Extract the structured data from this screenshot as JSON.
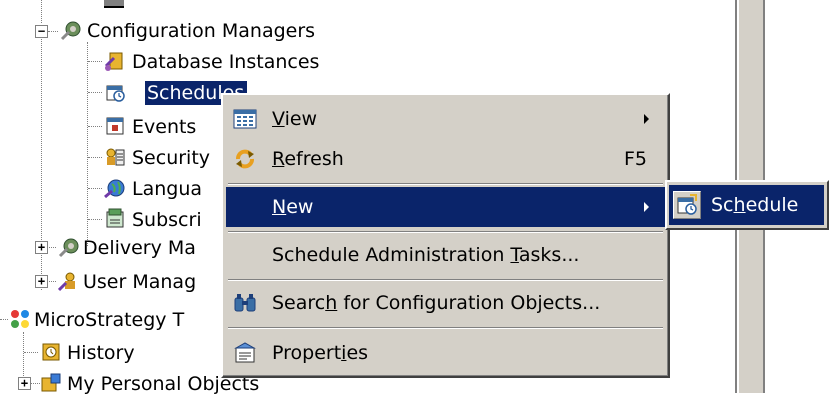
{
  "tree": {
    "items": [
      {
        "label": "Configuration Managers",
        "icon": "gear-wrench-icon",
        "toggle": "−"
      },
      {
        "label": "Database Instances",
        "icon": "database-instance-icon"
      },
      {
        "label": "Schedules",
        "icon": "schedule-icon",
        "selected": true
      },
      {
        "label": "Events",
        "icon": "event-icon"
      },
      {
        "label": "Security",
        "icon": "security-icon"
      },
      {
        "label": "Langua",
        "icon": "language-globe-icon"
      },
      {
        "label": "Subscri",
        "icon": "subscription-icon"
      },
      {
        "label": "Delivery Ma",
        "icon": "gear-wrench-icon",
        "toggle": "+"
      },
      {
        "label": "User Manag",
        "icon": "user-manager-icon",
        "toggle": "+"
      },
      {
        "label": "MicroStrategy T",
        "icon": "project-source-icon"
      },
      {
        "label": "History",
        "icon": "history-icon"
      },
      {
        "label": "My Personal Objects",
        "icon": "personal-objects-icon",
        "toggle": "+"
      }
    ]
  },
  "context_menu": {
    "items": [
      {
        "label": "View",
        "mnemonic": "V",
        "icon": "view-icon",
        "submenu": true
      },
      {
        "label": "Refresh",
        "mnemonic": "R",
        "icon": "refresh-icon",
        "shortcut": "F5"
      },
      {
        "label": "New",
        "mnemonic": "N",
        "submenu": true,
        "highlighted": true
      },
      {
        "label": "Schedule Administration Tasks...",
        "mnemonic": "T"
      },
      {
        "label": "Search for Configuration Objects...",
        "mnemonic": "h",
        "icon": "binoculars-icon"
      },
      {
        "label": "Properties",
        "mnemonic": "i",
        "icon": "properties-icon"
      }
    ]
  },
  "submenu": {
    "items": [
      {
        "label": "Schedule",
        "mnemonic": "h",
        "icon": "new-schedule-icon",
        "highlighted": true
      }
    ]
  },
  "colors": {
    "highlight": "#0a246a",
    "menu_face": "#d4d0c8",
    "selection_text_bg": "#0a246a"
  }
}
